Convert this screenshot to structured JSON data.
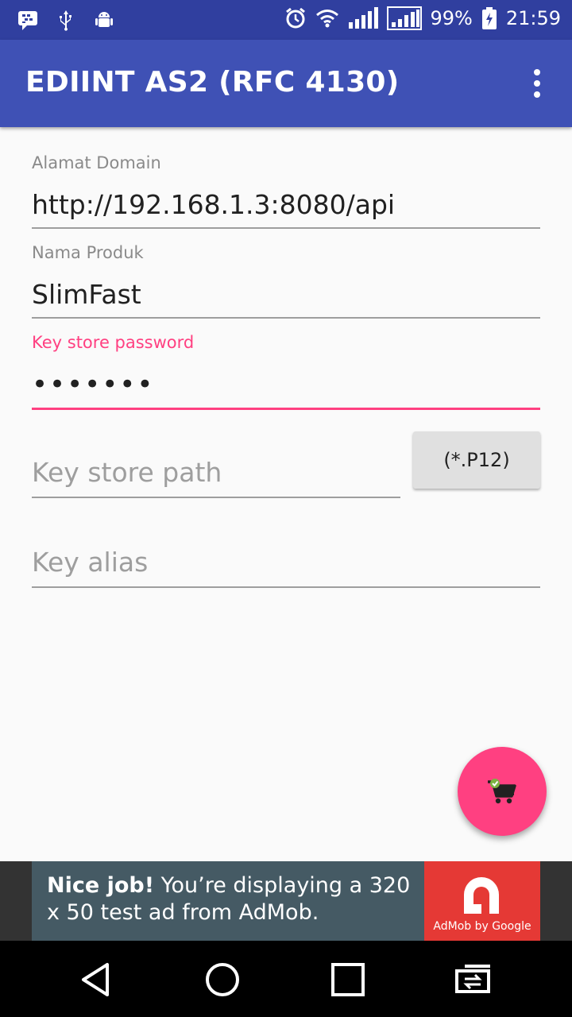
{
  "status_bar": {
    "battery_percent": "99%",
    "time": "21:59"
  },
  "app_bar": {
    "title": "EDIINT AS2 (RFC 4130)"
  },
  "form": {
    "domain_label": "Alamat Domain",
    "domain_value": "http://192.168.1.3:8080/api",
    "product_label": "Nama Produk",
    "product_value": "SlimFast",
    "password_label": "Key store password",
    "password_mask": "•••••••",
    "keystore_path_placeholder": "Key store path",
    "p12_button_label": "(*.P12)",
    "key_alias_placeholder": "Key alias"
  },
  "ad": {
    "headline": "Nice job!",
    "body": " You’re displaying a 320 x 50 test ad from AdMob.",
    "brand": "AdMob by Google"
  },
  "colors": {
    "primary": "#3f51b5",
    "primary_dark": "#303f9f",
    "accent": "#ff4081"
  },
  "icons": {
    "fab": "cart-icon",
    "overflow": "more-vert-icon"
  }
}
